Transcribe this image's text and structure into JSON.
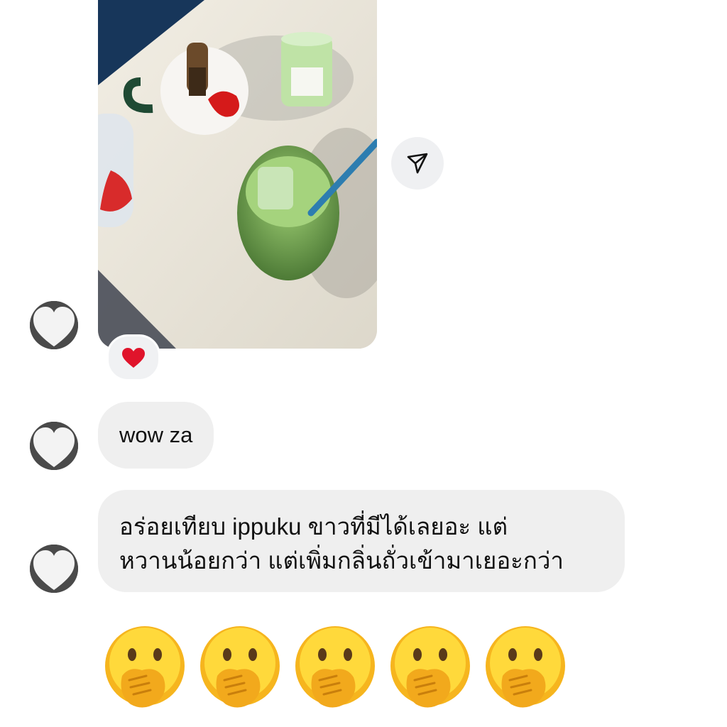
{
  "messages": {
    "text_1": "wow za",
    "text_2_line_1": "อร่อยเทียบ ippuku ขาวที่มีได้เลยอะ แต่",
    "text_2_line_2": "หวานน้อยกว่า แต่เพิ่มกลิ่นถั่วเข้ามาเยอะกว่า"
  },
  "reaction": {
    "icon": "red-heart-icon",
    "color": "#e0142b"
  },
  "share_button": {
    "icon": "paper-plane-icon"
  },
  "emoji_row": {
    "icon": "face-with-hand-over-mouth-icon",
    "count": 5
  },
  "colors": {
    "bubble": "#efefef",
    "share_button_bg": "#eff0f2",
    "text": "#111111"
  }
}
